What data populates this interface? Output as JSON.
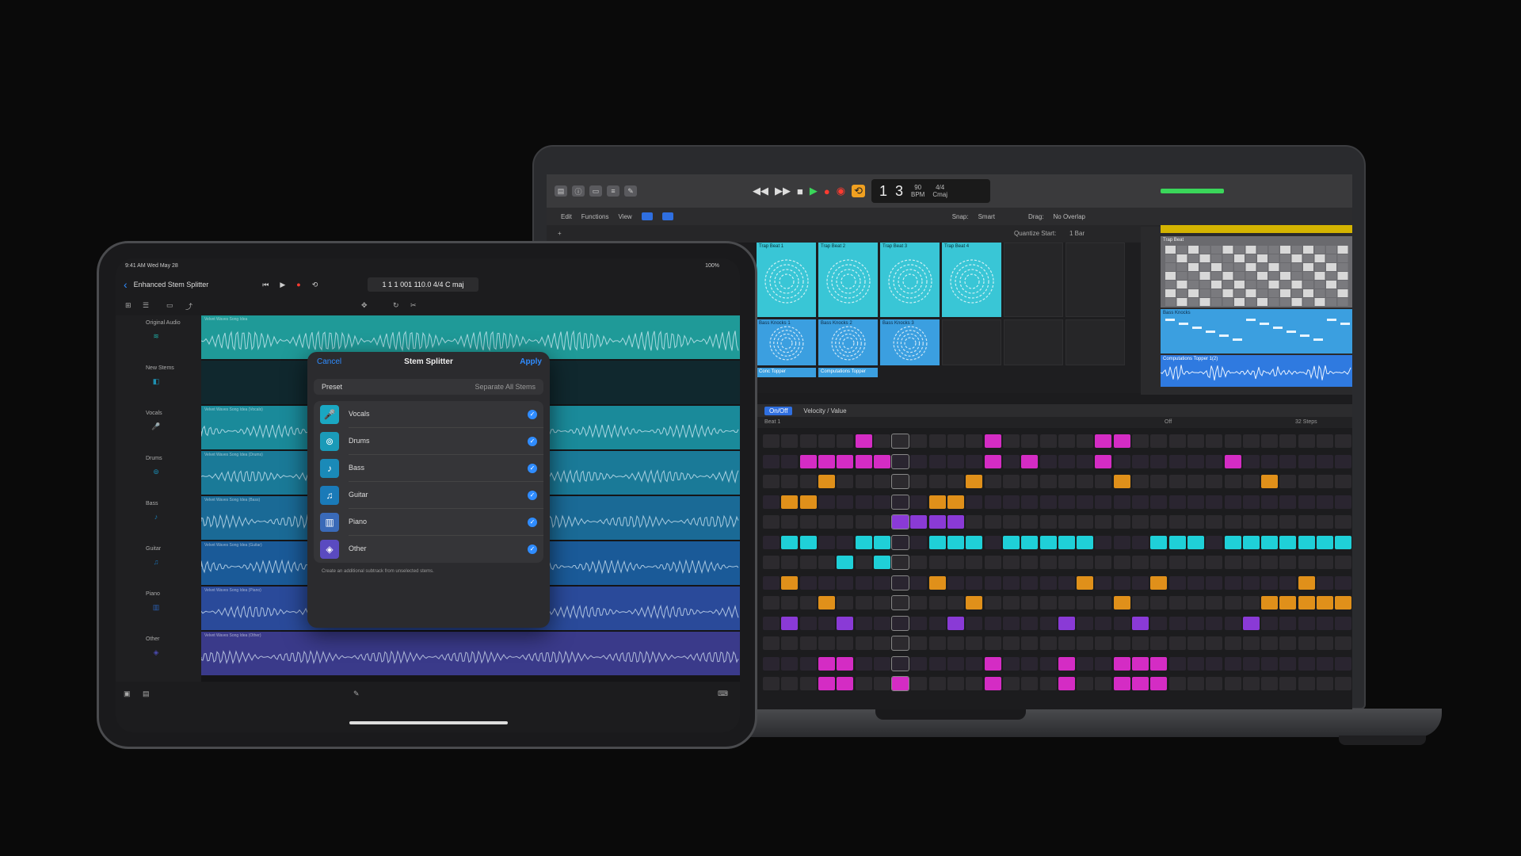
{
  "mac": {
    "lcd": {
      "bar": "1",
      "beat": "3",
      "tempo": "90",
      "tempo_label": "BPM",
      "sig": "4/4",
      "key": "Cmaj"
    },
    "edit_bar": [
      "Edit",
      "Functions",
      "View"
    ],
    "sub_bar": {
      "snap_label": "Snap:",
      "snap": "Smart",
      "drag_label": "Drag:",
      "drag": "No Overlap",
      "quantize_label": "Quantize Start:",
      "quantize": "1 Bar"
    },
    "cells_row1": [
      "Trap Beat 1",
      "Trap Beat 2",
      "Trap Beat 3",
      "Trap Beat 4"
    ],
    "cells_row2": [
      "Bass Knocks 1",
      "Bass Knocks 2",
      "Bass Knocks 3"
    ],
    "cells_row3": [
      "Conc Topper",
      "Computations Topper"
    ],
    "regions": {
      "beat": "Trap Beat",
      "bass": "Bass Knocks",
      "topper": "Computations Topper 1(2)"
    },
    "seq": {
      "onoff": "On/Off",
      "velocity": "Velocity / Value",
      "row_label": "Beat 1",
      "off": "Off",
      "steps": "32 Steps"
    }
  },
  "ipad": {
    "status_time": "9:41 AM  Wed May 28",
    "status_right": "100%",
    "title": "Enhanced Stem Splitter",
    "lcd": "1 1 1 001  110.0  4/4 C maj",
    "tracks": [
      {
        "name": "Original Audio",
        "color": "#1fa7a0",
        "icon": "waveform-icon"
      },
      {
        "name": "New Stems",
        "color": "#1f8fb0",
        "icon": "stems-icon"
      },
      {
        "name": "Vocals",
        "color": "#1aa7c2",
        "icon": "mic-icon"
      },
      {
        "name": "Drums",
        "color": "#1a8fb8",
        "icon": "drum-icon"
      },
      {
        "name": "Bass",
        "color": "#1a7fb8",
        "icon": "bass-icon"
      },
      {
        "name": "Guitar",
        "color": "#1a6fb0",
        "icon": "guitar-icon"
      },
      {
        "name": "Piano",
        "color": "#2a5fb0",
        "icon": "piano-icon"
      },
      {
        "name": "Other",
        "color": "#4a4ab0",
        "icon": "other-icon"
      }
    ],
    "lane_labels": [
      "Velvet Waves Song Idea",
      "Velvet Waves Song Idea (Vocals)",
      "Velvet Waves Song Idea (Drums)",
      "Velvet Waves Song Idea (Bass)",
      "Velvet Waves Song Idea (Guitar)",
      "Velvet Waves Song Idea (Piano)",
      "Velvet Waves Song Idea (Other)"
    ],
    "popover": {
      "cancel": "Cancel",
      "title": "Stem Splitter",
      "apply": "Apply",
      "preset_label": "Preset",
      "preset_value": "Separate All Stems",
      "stems": [
        {
          "name": "Vocals",
          "icon": "mic-icon",
          "color": "#1aa7c2"
        },
        {
          "name": "Drums",
          "icon": "drum-icon",
          "color": "#1a9ab8"
        },
        {
          "name": "Bass",
          "icon": "bass-icon",
          "color": "#1a8ab8"
        },
        {
          "name": "Guitar",
          "icon": "guitar-icon",
          "color": "#1a7ab8"
        },
        {
          "name": "Piano",
          "icon": "piano-icon",
          "color": "#3a6ab8"
        },
        {
          "name": "Other",
          "icon": "other-icon",
          "color": "#5a4ac0"
        }
      ],
      "note": "Create an additional subtrack from unselected stems."
    }
  },
  "colors": {
    "teal": "#39c6d6",
    "magenta": "#d42cc4",
    "orange": "#e0901a",
    "purple": "#8a3ad6",
    "cyan": "#1fd0d8"
  }
}
